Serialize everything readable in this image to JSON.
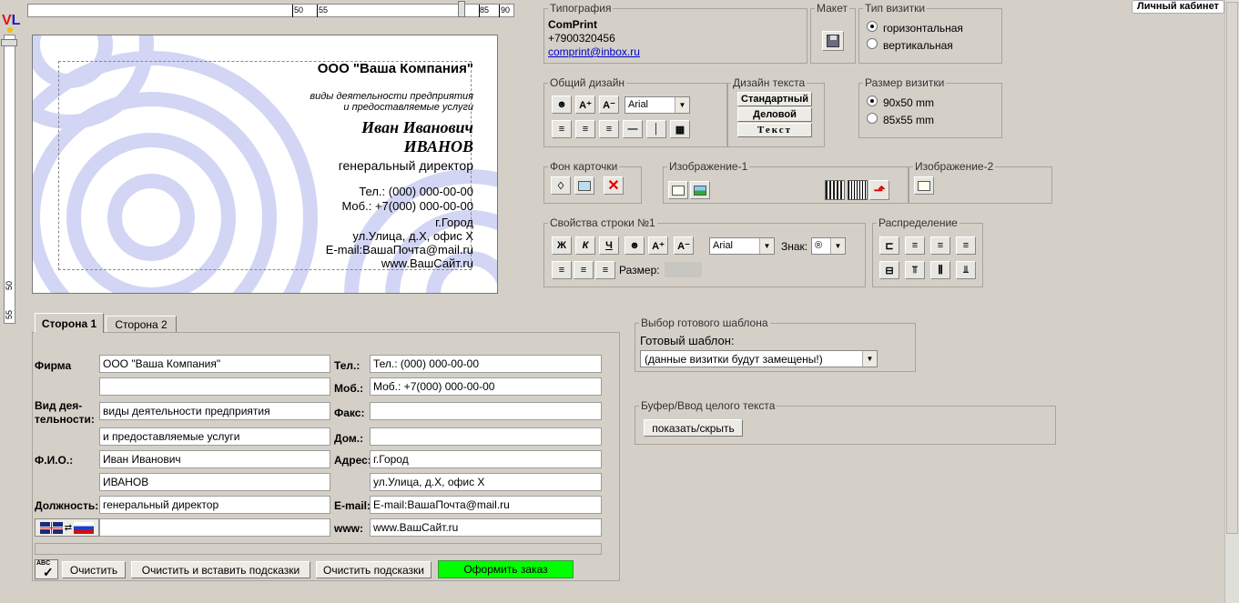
{
  "ruler": {
    "top_ticks": [
      "50",
      "55",
      "85",
      "90"
    ],
    "left_ticks": [
      "50",
      "55"
    ]
  },
  "card": {
    "company": "ООО \"Ваша Компания\"",
    "activity1": "виды деятельности предприятия",
    "activity2": "и предоставляемые услуги",
    "name1": "Иван Иванович",
    "name2": "ИВАНОВ",
    "position": "генеральный директор",
    "phone": "Тел.: (000) 000-00-00",
    "mobile": "Моб.: +7(000) 000-00-00",
    "city": "г.Город",
    "street": "ул.Улица, д.Х, офис Х",
    "email": "E-mail:ВашаПочта@mail.ru",
    "www": "www.ВашСайт.ru"
  },
  "tabs": [
    {
      "label": "Сторона 1",
      "active": true
    },
    {
      "label": "Сторона 2",
      "active": false
    }
  ],
  "form": {
    "firm_label": "Фирма",
    "firm": "ООО \"Ваша Компания\"",
    "activity_label": "Вид дея-\nтельности:",
    "activity1": "виды деятельности предприятия",
    "activity2": "и предоставляемые услуги",
    "fio_label": "Ф.И.О.:",
    "fio1": "Иван Иванович",
    "fio2": "ИВАНОВ",
    "position_label": "Должность:",
    "position": "генеральный директор",
    "tel_label": "Тел.:",
    "tel": "Тел.: (000) 000-00-00",
    "mob_label": "Моб.:",
    "mob": "Моб.: +7(000) 000-00-00",
    "fax_label": "Факс:",
    "fax": "",
    "home_label": "Дом.:",
    "home": "",
    "address_label": "Адрес:",
    "address1": "г.Город",
    "address2": "ул.Улица, д.Х, офис Х",
    "email_label": "E-mail:",
    "email": "E-mail:ВашаПочта@mail.ru",
    "www_label": "www:",
    "www": "www.ВашСайт.ru",
    "extra": ""
  },
  "buttons": {
    "clear": "Очистить",
    "clear_insert": "Очистить и вставить подсказки",
    "clear_hints": "Очистить подсказки",
    "order": "Оформить заказ",
    "spell": "ABC"
  },
  "typography": {
    "legend": "Типография",
    "name": "ComPrint",
    "phone": "+7900320456",
    "email": "comprint@inbox.ru"
  },
  "layout": {
    "legend": "Макет"
  },
  "card_type": {
    "legend": "Тип визитки",
    "options": [
      "горизонтальная",
      "вертикальная"
    ],
    "selected": 0
  },
  "general": {
    "legend": "Общий дизайн",
    "font": "Arial"
  },
  "text_design": {
    "legend": "Дизайн текста",
    "b1": "Стандартный",
    "b2": "Деловой",
    "b3": "Текст"
  },
  "size": {
    "legend": "Размер визитки",
    "options": [
      "90x50 mm",
      "85x55 mm"
    ],
    "selected": 0
  },
  "bg": {
    "legend": "Фон карточки"
  },
  "img1": {
    "legend": "Изображение-1"
  },
  "img2": {
    "legend": "Изображение-2"
  },
  "line": {
    "legend": "Свойства строки №1",
    "b": "Ж",
    "i": "К",
    "u": "Ч",
    "font": "Arial",
    "sign_label": "Знак:",
    "sign": "®",
    "size_label": "Размер:"
  },
  "distribution": {
    "legend": "Распределение"
  },
  "template": {
    "legend": "Выбор готового шаблона",
    "label": "Готовый шаблон:",
    "value": "(данные визитки будут замещены!)"
  },
  "buffer": {
    "legend": "Буфер/Ввод целого текста",
    "button": "показать/скрыть"
  },
  "cabinet": "Личный кабинет",
  "colors": {
    "bg": "#d4d0c8",
    "order": "#00ff00",
    "link": "#0000cc",
    "card_circles": "#c8ccf0"
  }
}
